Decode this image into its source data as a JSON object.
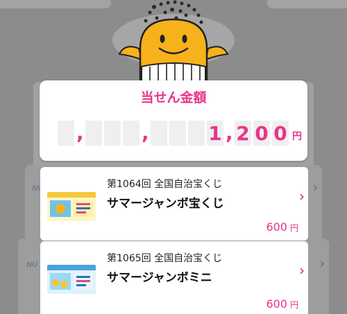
{
  "winnings": {
    "title": "当せん金額",
    "digits": [
      "",
      "",
      "",
      "",
      "",
      "",
      "",
      "1",
      "2",
      "0",
      "0"
    ],
    "separator": ",",
    "currency": "円"
  },
  "tickets": [
    {
      "round": "第1064回 全国自治宝くじ",
      "name": "サマージャンボ宝くじ",
      "amount": "600",
      "currency": "円"
    },
    {
      "round": "第1065回 全国自治宝くじ",
      "name": "サマージャンボミニ",
      "amount": "600",
      "currency": "円"
    }
  ],
  "background_logo": "NU",
  "colors": {
    "accent": "#e8348c",
    "mascot": "#f7b21b",
    "chevron": "#cc3333"
  }
}
